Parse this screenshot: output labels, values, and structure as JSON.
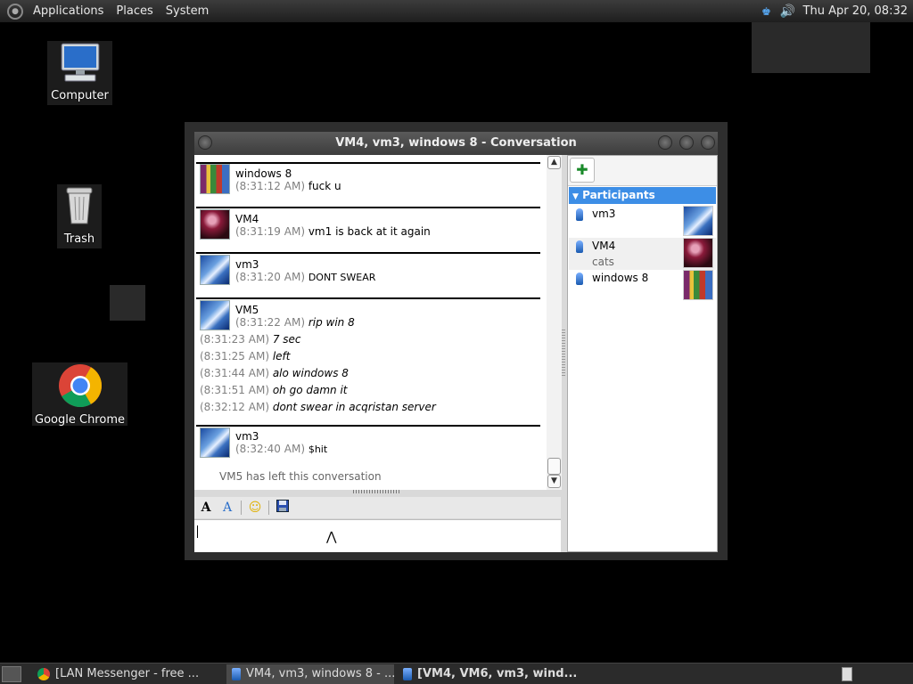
{
  "top_panel": {
    "menus": [
      "Applications",
      "Places",
      "System"
    ],
    "clock": "Thu Apr 20, 08:32",
    "tray_icons": [
      "lan-messenger-icon",
      "volume-icon"
    ]
  },
  "desktop": {
    "icons": [
      {
        "label": "Computer",
        "icon": "computer-icon"
      },
      {
        "label": "Trash",
        "icon": "trash-icon"
      },
      {
        "label": "Google Chrome",
        "icon": "chrome-icon"
      }
    ]
  },
  "window": {
    "title": "VM4, vm3, windows 8 - Conversation",
    "messages": [
      {
        "sender": "windows 8",
        "avatar": "bottles",
        "lines": [
          {
            "time": "(8:31:12 AM)",
            "text": "fuck u",
            "style": "normal"
          }
        ]
      },
      {
        "sender": "VM4",
        "avatar": "ball",
        "lines": [
          {
            "time": "(8:31:19 AM)",
            "text": "vm1 is back at it again",
            "style": "normal"
          }
        ]
      },
      {
        "sender": "vm3",
        "avatar": "fractal",
        "lines": [
          {
            "time": "(8:31:20 AM)",
            "text": "DONT SWEAR",
            "style": "small"
          }
        ]
      },
      {
        "sender": "VM5",
        "avatar": "fractal",
        "lines": [
          {
            "time": "(8:31:22 AM)",
            "text": "rip win 8",
            "style": "italic"
          },
          {
            "time": "(8:31:23 AM)",
            "text": "7 sec",
            "style": "italic"
          },
          {
            "time": "(8:31:25 AM)",
            "text": "left",
            "style": "italic"
          },
          {
            "time": "(8:31:44 AM)",
            "text": "alo windows 8",
            "style": "italic"
          },
          {
            "time": "(8:31:51 AM)",
            "text": "oh go damn it",
            "style": "italic"
          },
          {
            "time": "(8:32:12 AM)",
            "text": "dont swear in acqristan server",
            "style": "italic"
          }
        ]
      },
      {
        "sender": "vm3",
        "avatar": "fractal",
        "lines": [
          {
            "time": "(8:32:40 AM)",
            "text": "$hit",
            "style": "small"
          }
        ]
      }
    ],
    "system_message": "VM5 has left this conversation",
    "format_toolbar": [
      "font-icon",
      "font-color-icon",
      "emoticon-icon",
      "save-icon"
    ],
    "input_value": "",
    "participants_header": "Participants",
    "participants": [
      {
        "name": "vm3",
        "note": "",
        "avatar": "fractal"
      },
      {
        "name": "VM4",
        "note": "cats",
        "avatar": "ball"
      },
      {
        "name": "windows 8",
        "note": "",
        "avatar": "bottles"
      }
    ]
  },
  "taskbar": {
    "tasks": [
      {
        "label": "[LAN Messenger - free ...",
        "icon": "chrome-icon",
        "active": false,
        "bold": false
      },
      {
        "label": "VM4, vm3, windows 8 - ...",
        "icon": "lan-messenger-icon",
        "active": true,
        "bold": false
      },
      {
        "label": "[VM4, VM6, vm3, wind...",
        "icon": "lan-messenger-icon",
        "active": false,
        "bold": true
      }
    ]
  }
}
